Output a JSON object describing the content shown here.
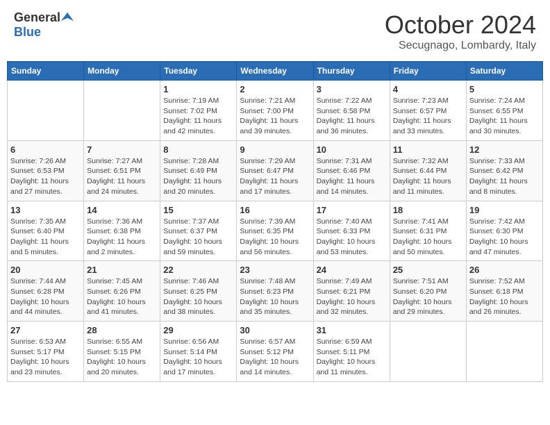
{
  "header": {
    "logo_general": "General",
    "logo_blue": "Blue",
    "month_title": "October 2024",
    "location": "Secugnago, Lombardy, Italy"
  },
  "days_of_week": [
    "Sunday",
    "Monday",
    "Tuesday",
    "Wednesday",
    "Thursday",
    "Friday",
    "Saturday"
  ],
  "weeks": [
    [
      {
        "day": "",
        "info": ""
      },
      {
        "day": "",
        "info": ""
      },
      {
        "day": "1",
        "info": "Sunrise: 7:19 AM\nSunset: 7:02 PM\nDaylight: 11 hours and 42 minutes."
      },
      {
        "day": "2",
        "info": "Sunrise: 7:21 AM\nSunset: 7:00 PM\nDaylight: 11 hours and 39 minutes."
      },
      {
        "day": "3",
        "info": "Sunrise: 7:22 AM\nSunset: 6:58 PM\nDaylight: 11 hours and 36 minutes."
      },
      {
        "day": "4",
        "info": "Sunrise: 7:23 AM\nSunset: 6:57 PM\nDaylight: 11 hours and 33 minutes."
      },
      {
        "day": "5",
        "info": "Sunrise: 7:24 AM\nSunset: 6:55 PM\nDaylight: 11 hours and 30 minutes."
      }
    ],
    [
      {
        "day": "6",
        "info": "Sunrise: 7:26 AM\nSunset: 6:53 PM\nDaylight: 11 hours and 27 minutes."
      },
      {
        "day": "7",
        "info": "Sunrise: 7:27 AM\nSunset: 6:51 PM\nDaylight: 11 hours and 24 minutes."
      },
      {
        "day": "8",
        "info": "Sunrise: 7:28 AM\nSunset: 6:49 PM\nDaylight: 11 hours and 20 minutes."
      },
      {
        "day": "9",
        "info": "Sunrise: 7:29 AM\nSunset: 6:47 PM\nDaylight: 11 hours and 17 minutes."
      },
      {
        "day": "10",
        "info": "Sunrise: 7:31 AM\nSunset: 6:46 PM\nDaylight: 11 hours and 14 minutes."
      },
      {
        "day": "11",
        "info": "Sunrise: 7:32 AM\nSunset: 6:44 PM\nDaylight: 11 hours and 11 minutes."
      },
      {
        "day": "12",
        "info": "Sunrise: 7:33 AM\nSunset: 6:42 PM\nDaylight: 11 hours and 8 minutes."
      }
    ],
    [
      {
        "day": "13",
        "info": "Sunrise: 7:35 AM\nSunset: 6:40 PM\nDaylight: 11 hours and 5 minutes."
      },
      {
        "day": "14",
        "info": "Sunrise: 7:36 AM\nSunset: 6:38 PM\nDaylight: 11 hours and 2 minutes."
      },
      {
        "day": "15",
        "info": "Sunrise: 7:37 AM\nSunset: 6:37 PM\nDaylight: 10 hours and 59 minutes."
      },
      {
        "day": "16",
        "info": "Sunrise: 7:39 AM\nSunset: 6:35 PM\nDaylight: 10 hours and 56 minutes."
      },
      {
        "day": "17",
        "info": "Sunrise: 7:40 AM\nSunset: 6:33 PM\nDaylight: 10 hours and 53 minutes."
      },
      {
        "day": "18",
        "info": "Sunrise: 7:41 AM\nSunset: 6:31 PM\nDaylight: 10 hours and 50 minutes."
      },
      {
        "day": "19",
        "info": "Sunrise: 7:42 AM\nSunset: 6:30 PM\nDaylight: 10 hours and 47 minutes."
      }
    ],
    [
      {
        "day": "20",
        "info": "Sunrise: 7:44 AM\nSunset: 6:28 PM\nDaylight: 10 hours and 44 minutes."
      },
      {
        "day": "21",
        "info": "Sunrise: 7:45 AM\nSunset: 6:26 PM\nDaylight: 10 hours and 41 minutes."
      },
      {
        "day": "22",
        "info": "Sunrise: 7:46 AM\nSunset: 6:25 PM\nDaylight: 10 hours and 38 minutes."
      },
      {
        "day": "23",
        "info": "Sunrise: 7:48 AM\nSunset: 6:23 PM\nDaylight: 10 hours and 35 minutes."
      },
      {
        "day": "24",
        "info": "Sunrise: 7:49 AM\nSunset: 6:21 PM\nDaylight: 10 hours and 32 minutes."
      },
      {
        "day": "25",
        "info": "Sunrise: 7:51 AM\nSunset: 6:20 PM\nDaylight: 10 hours and 29 minutes."
      },
      {
        "day": "26",
        "info": "Sunrise: 7:52 AM\nSunset: 6:18 PM\nDaylight: 10 hours and 26 minutes."
      }
    ],
    [
      {
        "day": "27",
        "info": "Sunrise: 6:53 AM\nSunset: 5:17 PM\nDaylight: 10 hours and 23 minutes."
      },
      {
        "day": "28",
        "info": "Sunrise: 6:55 AM\nSunset: 5:15 PM\nDaylight: 10 hours and 20 minutes."
      },
      {
        "day": "29",
        "info": "Sunrise: 6:56 AM\nSunset: 5:14 PM\nDaylight: 10 hours and 17 minutes."
      },
      {
        "day": "30",
        "info": "Sunrise: 6:57 AM\nSunset: 5:12 PM\nDaylight: 10 hours and 14 minutes."
      },
      {
        "day": "31",
        "info": "Sunrise: 6:59 AM\nSunset: 5:11 PM\nDaylight: 10 hours and 11 minutes."
      },
      {
        "day": "",
        "info": ""
      },
      {
        "day": "",
        "info": ""
      }
    ]
  ]
}
